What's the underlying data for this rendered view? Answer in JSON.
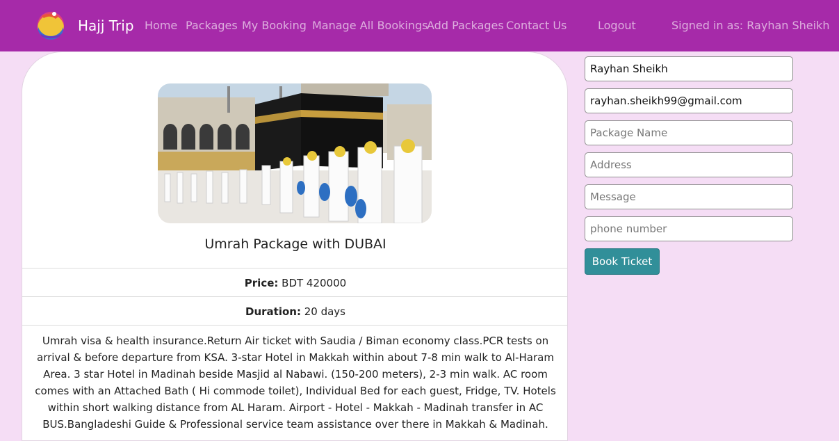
{
  "navbar": {
    "brand": "Hajj Trip",
    "links": [
      {
        "label": "Home"
      },
      {
        "label": "Packages"
      },
      {
        "label": "My Booking"
      },
      {
        "label": "Manage All Bookings"
      },
      {
        "label": "Add Packages"
      },
      {
        "label": "Contact Us"
      },
      {
        "label": "Logout"
      }
    ],
    "signed_in": "Signed in as: Rayhan Sheikh"
  },
  "package": {
    "image_icon": "kaaba-photo",
    "title": "Umrah Package with DUBAI",
    "price_label": "Price:",
    "price_value": " BDT 420000",
    "duration_label": "Duration:",
    "duration_value": " 20 days",
    "description": "Umrah visa & health insurance.Return Air ticket with Saudia / Biman economy class.PCR tests on arrival & before departure from KSA. 3-star Hotel in Makkah within about 7-8 min walk to Al-Haram Area. 3 star Hotel in Madinah beside Masjid al Nabawi. (150-200 meters), 2-3 min walk. AC room comes with an Attached Bath ( Hi commode toilet), Individual Bed for each guest, Fridge, TV. Hotels within short walking distance from AL Haram. Airport - Hotel - Makkah - Madinah transfer in AC BUS.Bangladeshi Guide & Professional service team assistance over there in Makkah & Madinah."
  },
  "form": {
    "name_value": "Rayhan Sheikh",
    "email_value": "rayhan.sheikh99@gmail.com",
    "package_placeholder": "Package Name",
    "address_placeholder": "Address",
    "message_placeholder": "Message",
    "phone_placeholder": "phone number",
    "submit_label": "Book Ticket"
  },
  "colors": {
    "navbar": "#a62aa9",
    "page_background": "#f5ddf5",
    "button": "#318f99"
  }
}
